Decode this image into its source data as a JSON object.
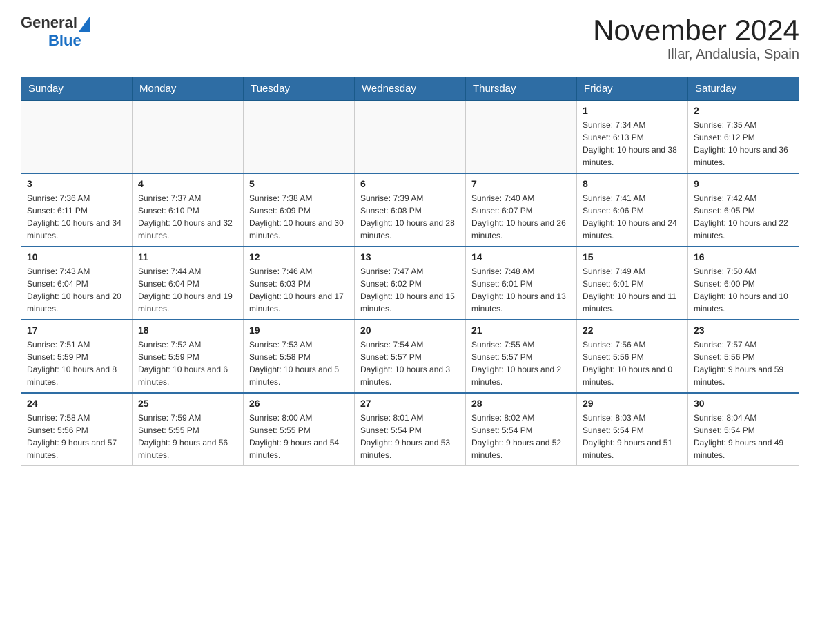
{
  "header": {
    "logo_general": "General",
    "logo_blue": "Blue",
    "title": "November 2024",
    "location": "Illar, Andalusia, Spain"
  },
  "weekdays": [
    "Sunday",
    "Monday",
    "Tuesday",
    "Wednesday",
    "Thursday",
    "Friday",
    "Saturday"
  ],
  "weeks": [
    [
      {
        "day": "",
        "sunrise": "",
        "sunset": "",
        "daylight": ""
      },
      {
        "day": "",
        "sunrise": "",
        "sunset": "",
        "daylight": ""
      },
      {
        "day": "",
        "sunrise": "",
        "sunset": "",
        "daylight": ""
      },
      {
        "day": "",
        "sunrise": "",
        "sunset": "",
        "daylight": ""
      },
      {
        "day": "",
        "sunrise": "",
        "sunset": "",
        "daylight": ""
      },
      {
        "day": "1",
        "sunrise": "Sunrise: 7:34 AM",
        "sunset": "Sunset: 6:13 PM",
        "daylight": "Daylight: 10 hours and 38 minutes."
      },
      {
        "day": "2",
        "sunrise": "Sunrise: 7:35 AM",
        "sunset": "Sunset: 6:12 PM",
        "daylight": "Daylight: 10 hours and 36 minutes."
      }
    ],
    [
      {
        "day": "3",
        "sunrise": "Sunrise: 7:36 AM",
        "sunset": "Sunset: 6:11 PM",
        "daylight": "Daylight: 10 hours and 34 minutes."
      },
      {
        "day": "4",
        "sunrise": "Sunrise: 7:37 AM",
        "sunset": "Sunset: 6:10 PM",
        "daylight": "Daylight: 10 hours and 32 minutes."
      },
      {
        "day": "5",
        "sunrise": "Sunrise: 7:38 AM",
        "sunset": "Sunset: 6:09 PM",
        "daylight": "Daylight: 10 hours and 30 minutes."
      },
      {
        "day": "6",
        "sunrise": "Sunrise: 7:39 AM",
        "sunset": "Sunset: 6:08 PM",
        "daylight": "Daylight: 10 hours and 28 minutes."
      },
      {
        "day": "7",
        "sunrise": "Sunrise: 7:40 AM",
        "sunset": "Sunset: 6:07 PM",
        "daylight": "Daylight: 10 hours and 26 minutes."
      },
      {
        "day": "8",
        "sunrise": "Sunrise: 7:41 AM",
        "sunset": "Sunset: 6:06 PM",
        "daylight": "Daylight: 10 hours and 24 minutes."
      },
      {
        "day": "9",
        "sunrise": "Sunrise: 7:42 AM",
        "sunset": "Sunset: 6:05 PM",
        "daylight": "Daylight: 10 hours and 22 minutes."
      }
    ],
    [
      {
        "day": "10",
        "sunrise": "Sunrise: 7:43 AM",
        "sunset": "Sunset: 6:04 PM",
        "daylight": "Daylight: 10 hours and 20 minutes."
      },
      {
        "day": "11",
        "sunrise": "Sunrise: 7:44 AM",
        "sunset": "Sunset: 6:04 PM",
        "daylight": "Daylight: 10 hours and 19 minutes."
      },
      {
        "day": "12",
        "sunrise": "Sunrise: 7:46 AM",
        "sunset": "Sunset: 6:03 PM",
        "daylight": "Daylight: 10 hours and 17 minutes."
      },
      {
        "day": "13",
        "sunrise": "Sunrise: 7:47 AM",
        "sunset": "Sunset: 6:02 PM",
        "daylight": "Daylight: 10 hours and 15 minutes."
      },
      {
        "day": "14",
        "sunrise": "Sunrise: 7:48 AM",
        "sunset": "Sunset: 6:01 PM",
        "daylight": "Daylight: 10 hours and 13 minutes."
      },
      {
        "day": "15",
        "sunrise": "Sunrise: 7:49 AM",
        "sunset": "Sunset: 6:01 PM",
        "daylight": "Daylight: 10 hours and 11 minutes."
      },
      {
        "day": "16",
        "sunrise": "Sunrise: 7:50 AM",
        "sunset": "Sunset: 6:00 PM",
        "daylight": "Daylight: 10 hours and 10 minutes."
      }
    ],
    [
      {
        "day": "17",
        "sunrise": "Sunrise: 7:51 AM",
        "sunset": "Sunset: 5:59 PM",
        "daylight": "Daylight: 10 hours and 8 minutes."
      },
      {
        "day": "18",
        "sunrise": "Sunrise: 7:52 AM",
        "sunset": "Sunset: 5:59 PM",
        "daylight": "Daylight: 10 hours and 6 minutes."
      },
      {
        "day": "19",
        "sunrise": "Sunrise: 7:53 AM",
        "sunset": "Sunset: 5:58 PM",
        "daylight": "Daylight: 10 hours and 5 minutes."
      },
      {
        "day": "20",
        "sunrise": "Sunrise: 7:54 AM",
        "sunset": "Sunset: 5:57 PM",
        "daylight": "Daylight: 10 hours and 3 minutes."
      },
      {
        "day": "21",
        "sunrise": "Sunrise: 7:55 AM",
        "sunset": "Sunset: 5:57 PM",
        "daylight": "Daylight: 10 hours and 2 minutes."
      },
      {
        "day": "22",
        "sunrise": "Sunrise: 7:56 AM",
        "sunset": "Sunset: 5:56 PM",
        "daylight": "Daylight: 10 hours and 0 minutes."
      },
      {
        "day": "23",
        "sunrise": "Sunrise: 7:57 AM",
        "sunset": "Sunset: 5:56 PM",
        "daylight": "Daylight: 9 hours and 59 minutes."
      }
    ],
    [
      {
        "day": "24",
        "sunrise": "Sunrise: 7:58 AM",
        "sunset": "Sunset: 5:56 PM",
        "daylight": "Daylight: 9 hours and 57 minutes."
      },
      {
        "day": "25",
        "sunrise": "Sunrise: 7:59 AM",
        "sunset": "Sunset: 5:55 PM",
        "daylight": "Daylight: 9 hours and 56 minutes."
      },
      {
        "day": "26",
        "sunrise": "Sunrise: 8:00 AM",
        "sunset": "Sunset: 5:55 PM",
        "daylight": "Daylight: 9 hours and 54 minutes."
      },
      {
        "day": "27",
        "sunrise": "Sunrise: 8:01 AM",
        "sunset": "Sunset: 5:54 PM",
        "daylight": "Daylight: 9 hours and 53 minutes."
      },
      {
        "day": "28",
        "sunrise": "Sunrise: 8:02 AM",
        "sunset": "Sunset: 5:54 PM",
        "daylight": "Daylight: 9 hours and 52 minutes."
      },
      {
        "day": "29",
        "sunrise": "Sunrise: 8:03 AM",
        "sunset": "Sunset: 5:54 PM",
        "daylight": "Daylight: 9 hours and 51 minutes."
      },
      {
        "day": "30",
        "sunrise": "Sunrise: 8:04 AM",
        "sunset": "Sunset: 5:54 PM",
        "daylight": "Daylight: 9 hours and 49 minutes."
      }
    ]
  ]
}
